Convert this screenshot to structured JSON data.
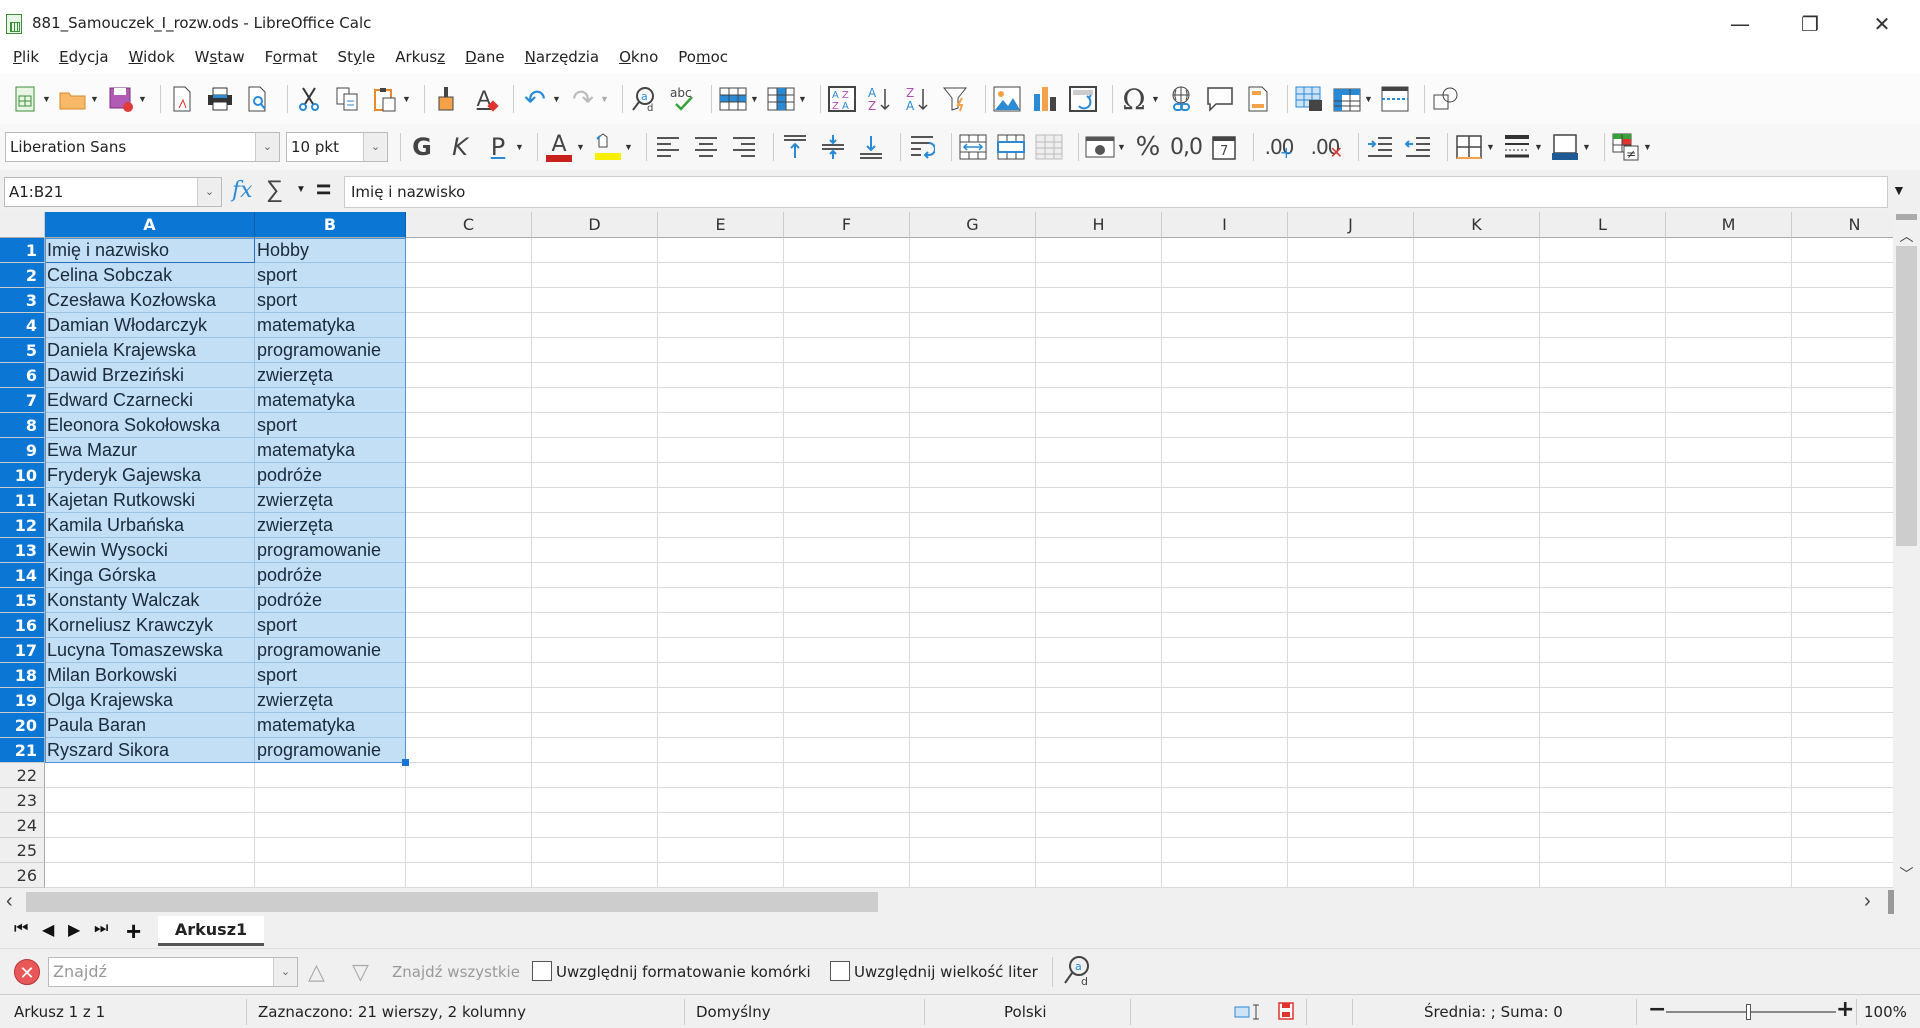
{
  "window": {
    "title": "881_Samouczek_I_rozw.ods - LibreOffice Calc",
    "controls": {
      "minimize": "—",
      "restore": "❐",
      "close": "✕"
    }
  },
  "menu": [
    {
      "label": "Plik",
      "accel": "P"
    },
    {
      "label": "Edycja",
      "accel": "E"
    },
    {
      "label": "Widok",
      "accel": "W"
    },
    {
      "label": "Wstaw",
      "accel": "s"
    },
    {
      "label": "Format",
      "accel": "o"
    },
    {
      "label": "Style",
      "accel": "y"
    },
    {
      "label": "Arkusz",
      "accel": "z"
    },
    {
      "label": "Dane",
      "accel": "D"
    },
    {
      "label": "Narzędzia",
      "accel": "N"
    },
    {
      "label": "Okno",
      "accel": "O"
    },
    {
      "label": "Pomoc",
      "accel": "m"
    }
  ],
  "toolbar1": [
    "new-icon",
    "open-icon",
    "save-icon",
    "export-pdf-icon",
    "print-icon",
    "print-preview-icon",
    "cut-icon",
    "copy-icon",
    "paste-icon",
    "clone-formatting-icon",
    "clear-formatting-icon",
    "undo-icon",
    "redo-icon",
    "find-replace-icon",
    "spelling-icon",
    "row-icon",
    "column-icon",
    "sort-icon",
    "sort-ascending-icon",
    "sort-descending-icon",
    "autofilter-icon",
    "image-icon",
    "chart-icon",
    "pivot-table-icon",
    "special-character-icon",
    "hyperlink-icon",
    "comment-icon",
    "header-footer-icon",
    "define-print-area-icon",
    "freeze-rows-columns-icon",
    "split-window-icon",
    "show-draw-functions-icon"
  ],
  "toolbar2": {
    "font_name": "Liberation Sans",
    "font_size": "10 pkt",
    "bold": "G",
    "italic": "K",
    "underline": "P",
    "font_color": "#c9211e",
    "highlight_color": "#ffff00",
    "percent": "%",
    "number_format": "0,0",
    "add_decimal": ".00",
    "delete_decimal": ".00",
    "border_color": "#1e5a96"
  },
  "formula_bar": {
    "name_box": "A1:B21",
    "content": "Imię i nazwisko"
  },
  "columns": [
    "A",
    "B",
    "C",
    "D",
    "E",
    "F",
    "G",
    "H",
    "I",
    "J",
    "K",
    "L",
    "M",
    "N"
  ],
  "selected_columns": [
    "A",
    "B"
  ],
  "rows": [
    {
      "n": "1",
      "a": "Imię i nazwisko",
      "b": "Hobby"
    },
    {
      "n": "2",
      "a": "Celina Sobczak",
      "b": "sport"
    },
    {
      "n": "3",
      "a": "Czesława Kozłowska",
      "b": "sport"
    },
    {
      "n": "4",
      "a": "Damian Włodarczyk",
      "b": "matematyka"
    },
    {
      "n": "5",
      "a": "Daniela Krajewska",
      "b": "programowanie"
    },
    {
      "n": "6",
      "a": "Dawid Brzeziński",
      "b": "zwierzęta"
    },
    {
      "n": "7",
      "a": "Edward Czarnecki",
      "b": "matematyka"
    },
    {
      "n": "8",
      "a": "Eleonora Sokołowska",
      "b": "sport"
    },
    {
      "n": "9",
      "a": "Ewa Mazur",
      "b": "matematyka"
    },
    {
      "n": "10",
      "a": "Fryderyk Gajewska",
      "b": "podróże"
    },
    {
      "n": "11",
      "a": "Kajetan Rutkowski",
      "b": "zwierzęta"
    },
    {
      "n": "12",
      "a": "Kamila Urbańska",
      "b": "zwierzęta"
    },
    {
      "n": "13",
      "a": "Kewin Wysocki",
      "b": "programowanie"
    },
    {
      "n": "14",
      "a": "Kinga Górska",
      "b": "podróże"
    },
    {
      "n": "15",
      "a": "Konstanty Walczak",
      "b": "podróże"
    },
    {
      "n": "16",
      "a": "Korneliusz Krawczyk",
      "b": "sport"
    },
    {
      "n": "17",
      "a": "Lucyna Tomaszewska",
      "b": "programowanie"
    },
    {
      "n": "18",
      "a": "Milan Borkowski",
      "b": "sport"
    },
    {
      "n": "19",
      "a": "Olga Krajewska",
      "b": "zwierzęta"
    },
    {
      "n": "20",
      "a": "Paula Baran",
      "b": "matematyka"
    },
    {
      "n": "21",
      "a": "Ryszard Sikora",
      "b": "programowanie"
    },
    {
      "n": "22",
      "a": "",
      "b": ""
    },
    {
      "n": "23",
      "a": "",
      "b": ""
    },
    {
      "n": "24",
      "a": "",
      "b": ""
    },
    {
      "n": "25",
      "a": "",
      "b": ""
    },
    {
      "n": "26",
      "a": "",
      "b": ""
    }
  ],
  "selected_rows_count": 21,
  "sheet_tabs": [
    {
      "label": "Arkusz1",
      "active": true
    }
  ],
  "find_bar": {
    "placeholder": "Znajdź",
    "find_all": "Znajdź wszystkie",
    "match_formatting": "Uwzględnij formatowanie komórki",
    "match_case": "Uwzględnij wielkość liter"
  },
  "status_bar": {
    "sheet": "Arkusz 1 z 1",
    "selection": "Zaznaczono: 21 wierszy, 2 kolumny",
    "page_style": "Domyślny",
    "language": "Polski",
    "summary": "Średnia: ; Suma: 0",
    "zoom": "100%",
    "zoom_minus": "−",
    "zoom_plus": "+"
  },
  "colors": {
    "selection_header": "#0b76d4",
    "selection_fill": "#c2dff5"
  }
}
